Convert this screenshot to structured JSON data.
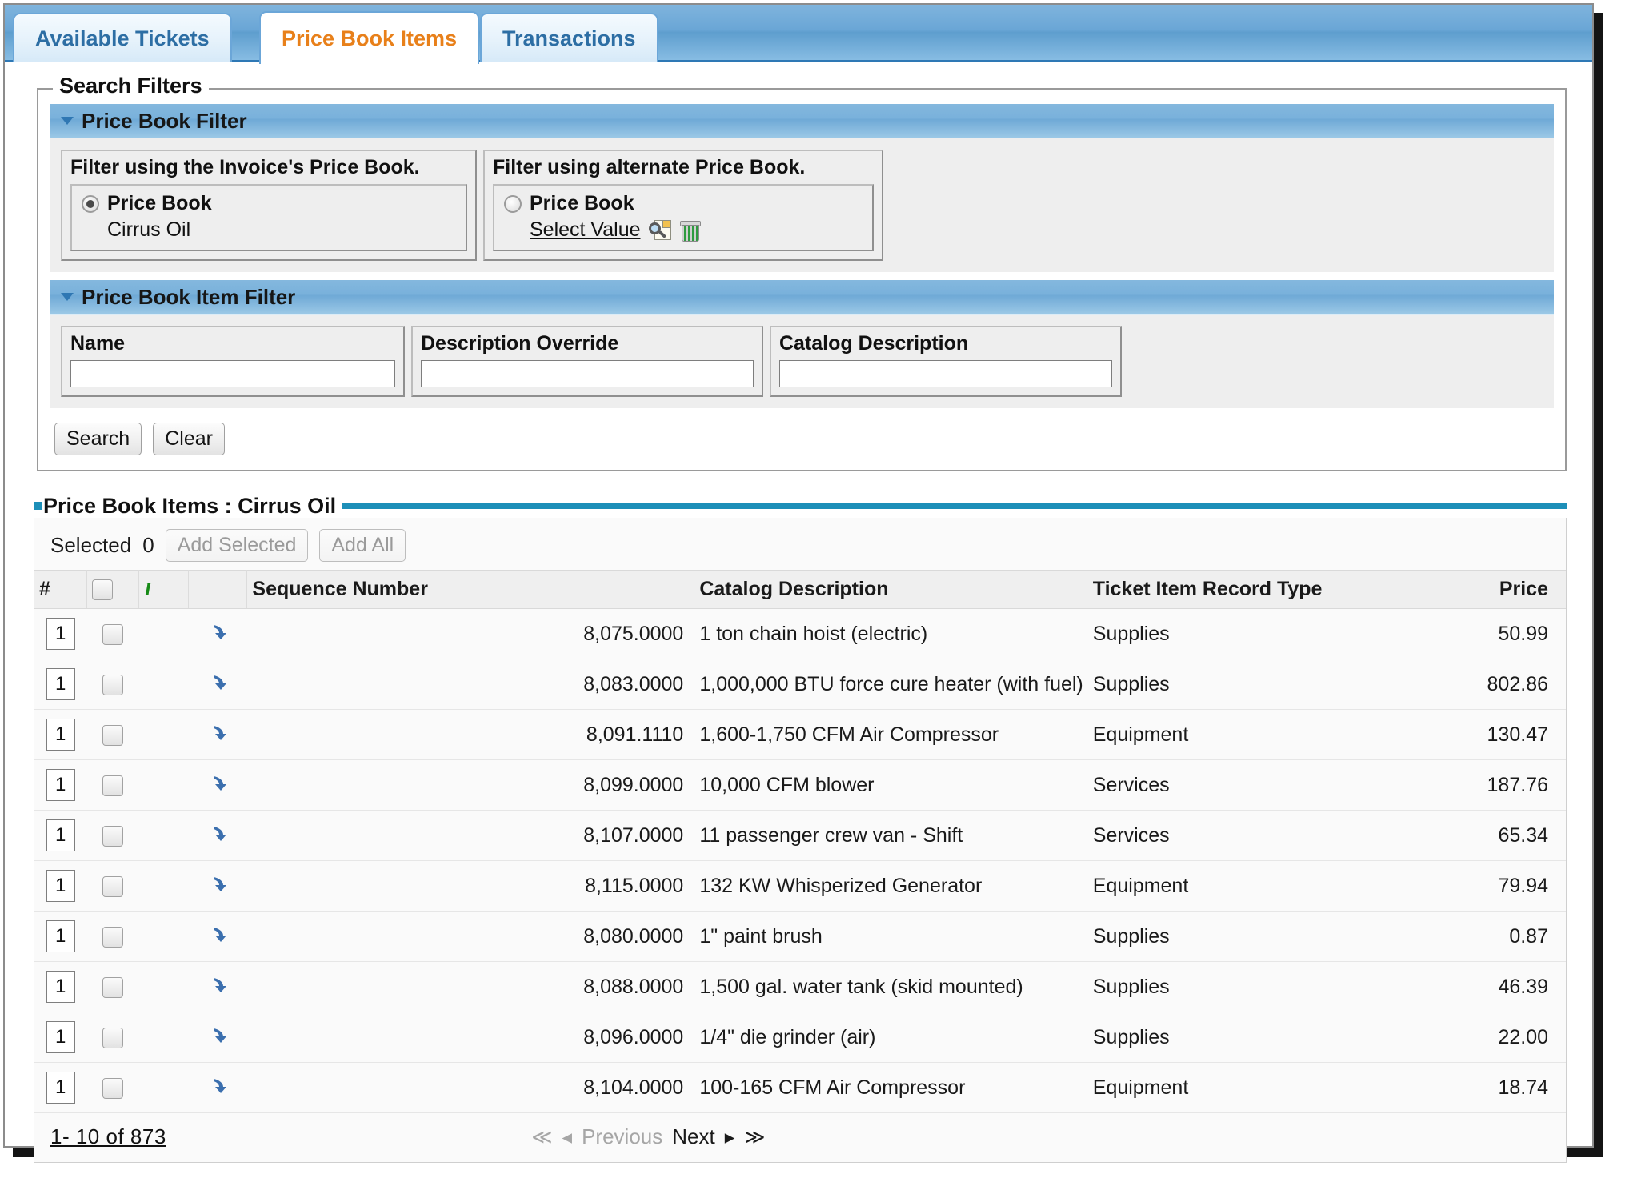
{
  "tabs": [
    {
      "label": "Available Tickets",
      "active": false
    },
    {
      "label": "Price Book Items",
      "active": true
    },
    {
      "label": "Transactions",
      "active": false
    }
  ],
  "search_filters": {
    "legend": "Search Filters",
    "price_book_filter": {
      "section_title": "Price Book Filter",
      "invoice_panel": {
        "title": "Filter using the Invoice's Price Book.",
        "radio_label": "Price Book",
        "radio_selected": true,
        "value": "Cirrus Oil"
      },
      "alternate_panel": {
        "title": "Filter using alternate Price Book.",
        "radio_label": "Price Book",
        "radio_selected": false,
        "select_link": "Select Value",
        "lookup_icon": "search-page-icon",
        "clear_icon": "trash-icon"
      }
    },
    "price_book_item_filter": {
      "section_title": "Price Book Item Filter",
      "fields": [
        {
          "label": "Name",
          "value": ""
        },
        {
          "label": "Description Override",
          "value": ""
        },
        {
          "label": "Catalog Description",
          "value": ""
        }
      ]
    },
    "buttons": {
      "search": "Search",
      "clear": "Clear"
    }
  },
  "results": {
    "title": "Price Book Items : Cirrus Oil",
    "selected_label": "Selected",
    "selected_count": "0",
    "add_selected_label": "Add Selected",
    "add_all_label": "Add All",
    "add_selected_enabled": false,
    "add_all_enabled": false,
    "columns": {
      "num": "#",
      "sequence": "Sequence Number",
      "catalog": "Catalog Description",
      "type": "Ticket Item Record Type",
      "price": "Price"
    },
    "rows": [
      {
        "qty": "1",
        "sequence": "8,075.0000",
        "catalog": "1 ton chain hoist (electric)",
        "type": "Supplies",
        "price": "50.99"
      },
      {
        "qty": "1",
        "sequence": "8,083.0000",
        "catalog": "1,000,000 BTU force cure heater (with fuel)",
        "type": "Supplies",
        "price": "802.86"
      },
      {
        "qty": "1",
        "sequence": "8,091.1110",
        "catalog": "1,600-1,750 CFM Air Compressor",
        "type": "Equipment",
        "price": "130.47"
      },
      {
        "qty": "1",
        "sequence": "8,099.0000",
        "catalog": "10,000 CFM blower",
        "type": "Services",
        "price": "187.76"
      },
      {
        "qty": "1",
        "sequence": "8,107.0000",
        "catalog": "11 passenger crew van - Shift",
        "type": "Services",
        "price": "65.34"
      },
      {
        "qty": "1",
        "sequence": "8,115.0000",
        "catalog": "132 KW Whisperized Generator",
        "type": "Equipment",
        "price": "79.94"
      },
      {
        "qty": "1",
        "sequence": "8,080.0000",
        "catalog": "1\" paint brush",
        "type": "Supplies",
        "price": "0.87"
      },
      {
        "qty": "1",
        "sequence": "8,088.0000",
        "catalog": "1,500 gal. water tank (skid mounted)",
        "type": "Supplies",
        "price": "46.39"
      },
      {
        "qty": "1",
        "sequence": "8,096.0000",
        "catalog": "1/4\" die grinder (air)",
        "type": "Supplies",
        "price": "22.00"
      },
      {
        "qty": "1",
        "sequence": "8,104.0000",
        "catalog": "100-165 CFM Air Compressor",
        "type": "Equipment",
        "price": "18.74"
      }
    ],
    "pagination": {
      "range_label": "1- 10  of  873",
      "first_glyph": "≪",
      "prev_glyph": "◂",
      "prev_label": "Previous",
      "next_label": "Next",
      "next_glyph": "▸",
      "last_glyph": "≫",
      "prev_enabled": false,
      "next_enabled": true
    }
  },
  "colors": {
    "tab_active_text": "#e8801a",
    "tab_inactive_text": "#2d6ea4",
    "section_bar": "#79b1db",
    "results_rule": "#1d8fb8",
    "go_arrow": "#3b6fae",
    "trash_green": "#2e9b3f"
  }
}
